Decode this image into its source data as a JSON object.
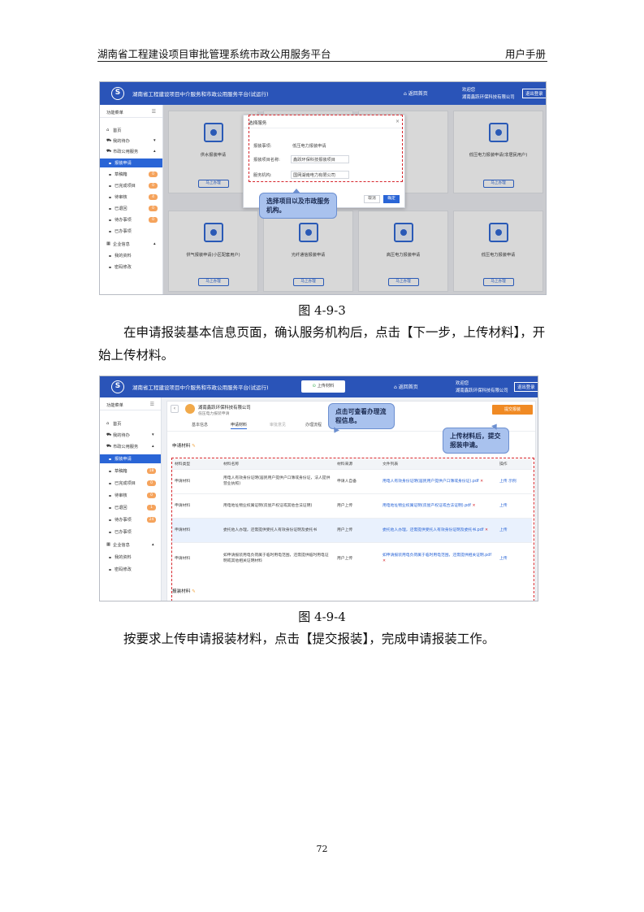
{
  "header": {
    "title": "湖南省工程建设项目审批管理系统市政公用服务平台",
    "right": "用户手册"
  },
  "fig1": {
    "app_title": "湖南省工程建设项目中介服务和市政公用服务平台(试运行)",
    "nav_home": "返回首页",
    "user_greeting": "欢迎您",
    "user_org": "湖南鑫跃环保科技有限公司",
    "logout": "退出登录",
    "sidebar": [
      {
        "label": "功能菜单"
      },
      {
        "label": "首页"
      },
      {
        "label": "我的待办"
      },
      {
        "label": "市政公用服务"
      },
      {
        "label": "报装申请"
      },
      {
        "label": "草稿箱",
        "badge": "0"
      },
      {
        "label": "已完成项目",
        "badge": "0"
      },
      {
        "label": "待审核",
        "badge": "4"
      },
      {
        "label": "已退回",
        "badge": "0"
      },
      {
        "label": "待办事项",
        "badge": "0"
      },
      {
        "label": "已办事项"
      },
      {
        "label": "企业信息"
      },
      {
        "label": "我的资料"
      },
      {
        "label": "密码修改"
      }
    ],
    "cards": [
      {
        "name": "供水报装申请",
        "button": "马上办理"
      },
      {
        "name": "",
        "button": ""
      },
      {
        "name": "",
        "button": ""
      },
      {
        "name": "低压电力报装申请(非居民用户)",
        "button": "马上办理"
      },
      {
        "name": "供气报装申请(小区配套用户)",
        "button": "马上办理"
      },
      {
        "name": "光纤通信报装申请",
        "button": "马上办理"
      },
      {
        "name": "高压电力报装申请",
        "button": "马上办理"
      },
      {
        "name": "低压电力报装申请",
        "button": "马上办理"
      }
    ],
    "modal": {
      "title": "选择服务",
      "rows": [
        {
          "label": "报装事项:",
          "value": "低压电力报装申请"
        },
        {
          "label": "报装项目名称:",
          "value": "鑫跃环保科技报装项目"
        },
        {
          "label": "服务机构:",
          "value": "国网湖南电力有限公司"
        }
      ],
      "cancel": "取消",
      "ok": "确定"
    },
    "callout": "选择项目以及市政服务机构。"
  },
  "caption1": "图 4-9-3",
  "paragraph1": "在申请报装基本信息页面，确认服务机构后，点击【下一步，上传材料】，开始上传材料。",
  "fig2": {
    "app_title": "湖南省工程建设项目中介服务和市政公用服务平台(试运行)",
    "center_button": "上传材料",
    "nav_home": "返回首页",
    "user_greeting": "欢迎您",
    "user_org": "湖南鑫跃环保科技有限公司",
    "logout": "退出登录",
    "sidebar": [
      {
        "label": "功能菜单"
      },
      {
        "label": "首页"
      },
      {
        "label": "我的待办"
      },
      {
        "label": "市政公用服务"
      },
      {
        "label": "报装申请"
      },
      {
        "label": "草稿箱",
        "badge": "18"
      },
      {
        "label": "已完成项目",
        "badge": "0"
      },
      {
        "label": "待审核",
        "badge": "0"
      },
      {
        "label": "已退回",
        "badge": "1"
      },
      {
        "label": "待办事项",
        "badge": "24"
      },
      {
        "label": "已办事项"
      },
      {
        "label": "企业信息"
      },
      {
        "label": "我的资料"
      },
      {
        "label": "密码修改"
      }
    ],
    "company": "湖南鑫跃环保科技有限公司",
    "company_sub": "低压电力报装申请",
    "tabs": [
      "基本信息",
      "申请材料",
      "审批意见",
      "办理流程"
    ],
    "submit": "提交报装",
    "section1": "申请材料",
    "section2": "报装材料",
    "table": {
      "headers": [
        "材料类型",
        "材料名称",
        "材料来源",
        "文件列表",
        "操作"
      ],
      "rows": [
        {
          "type": "申请材料",
          "name": "用电人有效身份证明(居民用户提供户口簿或身份证，法人提供营业执照)",
          "source": "申请人自备",
          "file": "用电人有效身份证明(居民用户提供户口簿或身份证)",
          "fmt": ".pdf",
          "action": "上传 示例"
        },
        {
          "type": "申请材料",
          "name": "用电地址物业权属证明(房屋产权证或其他合法证明)",
          "source": "用户上传",
          "file": "用电地址物业权属证明(房屋产权证或合法证明)",
          "fmt": ".pdf",
          "action": "上传"
        },
        {
          "type": "申请材料",
          "name": "委托他人办理，还需提供受托人有效身份证明及委托书",
          "source": "用户上传",
          "file": "委托他人办理，还需提供受托人有效身份证明及委托书",
          "fmt": ".pdf",
          "action": "上传"
        },
        {
          "type": "申请材料",
          "name": "如申请报装用电负荷属于临时用电范围，还需提供临时用电证明或其他相关证明材料",
          "source": "用户上传",
          "file": "如申请报装用电负荷属于临时用电范围，还需提供相关证明",
          "fmt": ".pdf",
          "action": "上传"
        }
      ]
    },
    "callout_flow": "点击可查看办理流程信息。",
    "callout_upload": "上传材料后，提交报装申请。"
  },
  "caption2": "图 4-9-4",
  "paragraph2": "按要求上传申请报装材料，点击【提交报装】，完成申请报装工作。",
  "page_number": "72",
  "colors": {
    "accent": "#2a54b8",
    "highlight": "#d6262c",
    "callout": "#a9c2ee"
  }
}
